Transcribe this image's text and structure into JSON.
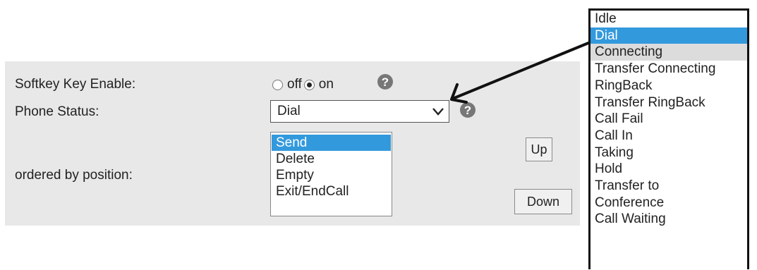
{
  "settings": {
    "softkey_label": "Softkey Key Enable:",
    "softkey_off": "off",
    "softkey_on": "on",
    "softkey_selected": "on",
    "phone_status_label": "Phone Status:",
    "phone_status_value": "Dial",
    "ordered_label": "ordered by position:"
  },
  "softkeys": [
    "Send",
    "Delete",
    "Empty",
    "Exit/EndCall"
  ],
  "softkeys_selected": "Send",
  "buttons": {
    "up": "Up",
    "down": "Down"
  },
  "phone_status_options": [
    "Idle",
    "Dial",
    "Connecting",
    "Transfer Connecting",
    "RingBack",
    "Transfer RingBack",
    "Call Fail",
    "Call In",
    "Taking",
    "Hold",
    "Transfer to",
    "Conference",
    "Call Waiting"
  ],
  "phone_status_highlighted": "Connecting",
  "colors": {
    "panel": "#e8e8e8",
    "selection": "#3399dd",
    "hover": "#dcdcdc",
    "help_icon": "#777777"
  },
  "icons": {
    "help": "help-icon",
    "dropdown": "chevron-down-icon",
    "callout": "arrow-icon"
  }
}
